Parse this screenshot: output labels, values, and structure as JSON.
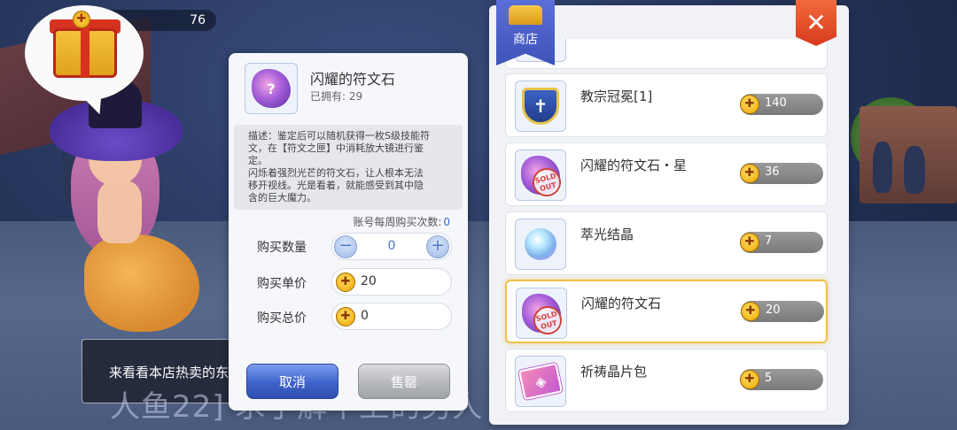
{
  "hud": {
    "counter": "76",
    "gift_coin_glyph": "✚"
  },
  "npc_dialog": {
    "text": "来看看本店热卖的东西"
  },
  "subtitle": {
    "text": "人鱼22] 求了解不上的男人"
  },
  "detail": {
    "name": "闪耀的符文石",
    "owned": "已拥有: 29",
    "icon_glyph": "?",
    "description_lines": [
      "描述：鉴定后可以随机获得一枚S级技能符",
      "文，在【符文之匣】中消耗放大镜进行鉴",
      "定。",
      "闪烁着强烈光芒的符文石，让人根本无法",
      "移开视线。光是看着，就能感受到其中隐",
      "含的巨大魔力。"
    ],
    "weekly_label": "账号每周购买次数:",
    "weekly_value": "0",
    "quantity_label": "购买数量",
    "quantity_value": "0",
    "minus_glyph": "−",
    "plus_glyph": "+",
    "unit_price_label": "购买单价",
    "unit_price_value": "20",
    "total_price_label": "购买总价",
    "total_price_value": "0",
    "cancel_label": "取消",
    "sell_label": "售罄"
  },
  "shop": {
    "title": "商店",
    "close_glyph": "✕",
    "sold_out_text": "SOLD OUT",
    "coin_glyph": "✚",
    "items": [
      {
        "name": "教宗冠冕[1]",
        "price": "140",
        "icon": "crown-icon",
        "sold_out": false,
        "selected": false
      },
      {
        "name": "闪耀的符文石・星",
        "price": "36",
        "icon": "rune-star-icon",
        "sold_out": true,
        "selected": false
      },
      {
        "name": "萃光结晶",
        "price": "7",
        "icon": "crystal-icon",
        "sold_out": false,
        "selected": false
      },
      {
        "name": "闪耀的符文石",
        "price": "20",
        "icon": "rune-stone-icon",
        "sold_out": true,
        "selected": true
      },
      {
        "name": "祈祷晶片包",
        "price": "5",
        "icon": "card-pack-icon",
        "sold_out": false,
        "selected": false
      }
    ]
  },
  "colors": {
    "accent_blue": "#3f63c9",
    "close_red": "#d73a1c",
    "selected_border": "#f0c14b",
    "coin_gold": "#f2b418"
  }
}
